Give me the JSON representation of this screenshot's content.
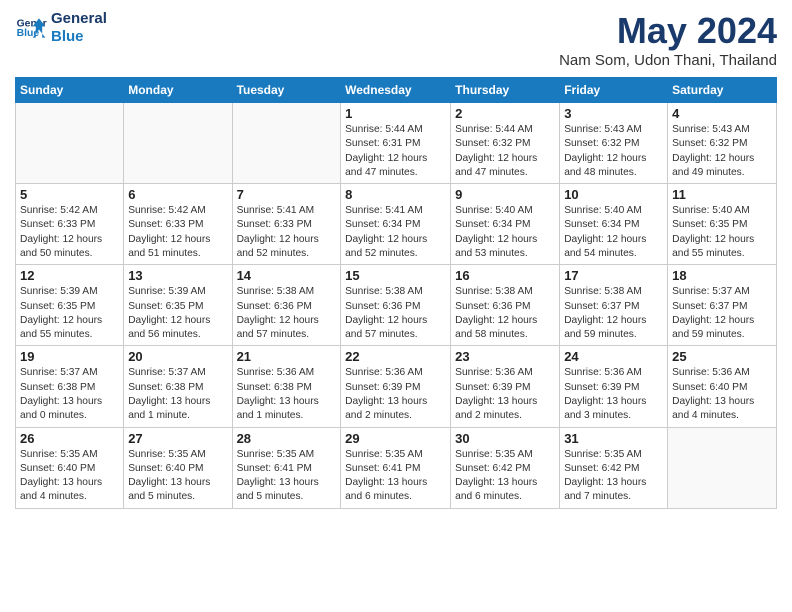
{
  "header": {
    "logo_line1": "General",
    "logo_line2": "Blue",
    "month_year": "May 2024",
    "location": "Nam Som, Udon Thani, Thailand"
  },
  "weekdays": [
    "Sunday",
    "Monday",
    "Tuesday",
    "Wednesday",
    "Thursday",
    "Friday",
    "Saturday"
  ],
  "weeks": [
    [
      {
        "day": "",
        "info": ""
      },
      {
        "day": "",
        "info": ""
      },
      {
        "day": "",
        "info": ""
      },
      {
        "day": "1",
        "info": "Sunrise: 5:44 AM\nSunset: 6:31 PM\nDaylight: 12 hours\nand 47 minutes."
      },
      {
        "day": "2",
        "info": "Sunrise: 5:44 AM\nSunset: 6:32 PM\nDaylight: 12 hours\nand 47 minutes."
      },
      {
        "day": "3",
        "info": "Sunrise: 5:43 AM\nSunset: 6:32 PM\nDaylight: 12 hours\nand 48 minutes."
      },
      {
        "day": "4",
        "info": "Sunrise: 5:43 AM\nSunset: 6:32 PM\nDaylight: 12 hours\nand 49 minutes."
      }
    ],
    [
      {
        "day": "5",
        "info": "Sunrise: 5:42 AM\nSunset: 6:33 PM\nDaylight: 12 hours\nand 50 minutes."
      },
      {
        "day": "6",
        "info": "Sunrise: 5:42 AM\nSunset: 6:33 PM\nDaylight: 12 hours\nand 51 minutes."
      },
      {
        "day": "7",
        "info": "Sunrise: 5:41 AM\nSunset: 6:33 PM\nDaylight: 12 hours\nand 52 minutes."
      },
      {
        "day": "8",
        "info": "Sunrise: 5:41 AM\nSunset: 6:34 PM\nDaylight: 12 hours\nand 52 minutes."
      },
      {
        "day": "9",
        "info": "Sunrise: 5:40 AM\nSunset: 6:34 PM\nDaylight: 12 hours\nand 53 minutes."
      },
      {
        "day": "10",
        "info": "Sunrise: 5:40 AM\nSunset: 6:34 PM\nDaylight: 12 hours\nand 54 minutes."
      },
      {
        "day": "11",
        "info": "Sunrise: 5:40 AM\nSunset: 6:35 PM\nDaylight: 12 hours\nand 55 minutes."
      }
    ],
    [
      {
        "day": "12",
        "info": "Sunrise: 5:39 AM\nSunset: 6:35 PM\nDaylight: 12 hours\nand 55 minutes."
      },
      {
        "day": "13",
        "info": "Sunrise: 5:39 AM\nSunset: 6:35 PM\nDaylight: 12 hours\nand 56 minutes."
      },
      {
        "day": "14",
        "info": "Sunrise: 5:38 AM\nSunset: 6:36 PM\nDaylight: 12 hours\nand 57 minutes."
      },
      {
        "day": "15",
        "info": "Sunrise: 5:38 AM\nSunset: 6:36 PM\nDaylight: 12 hours\nand 57 minutes."
      },
      {
        "day": "16",
        "info": "Sunrise: 5:38 AM\nSunset: 6:36 PM\nDaylight: 12 hours\nand 58 minutes."
      },
      {
        "day": "17",
        "info": "Sunrise: 5:38 AM\nSunset: 6:37 PM\nDaylight: 12 hours\nand 59 minutes."
      },
      {
        "day": "18",
        "info": "Sunrise: 5:37 AM\nSunset: 6:37 PM\nDaylight: 12 hours\nand 59 minutes."
      }
    ],
    [
      {
        "day": "19",
        "info": "Sunrise: 5:37 AM\nSunset: 6:38 PM\nDaylight: 13 hours\nand 0 minutes."
      },
      {
        "day": "20",
        "info": "Sunrise: 5:37 AM\nSunset: 6:38 PM\nDaylight: 13 hours\nand 1 minute."
      },
      {
        "day": "21",
        "info": "Sunrise: 5:36 AM\nSunset: 6:38 PM\nDaylight: 13 hours\nand 1 minutes."
      },
      {
        "day": "22",
        "info": "Sunrise: 5:36 AM\nSunset: 6:39 PM\nDaylight: 13 hours\nand 2 minutes."
      },
      {
        "day": "23",
        "info": "Sunrise: 5:36 AM\nSunset: 6:39 PM\nDaylight: 13 hours\nand 2 minutes."
      },
      {
        "day": "24",
        "info": "Sunrise: 5:36 AM\nSunset: 6:39 PM\nDaylight: 13 hours\nand 3 minutes."
      },
      {
        "day": "25",
        "info": "Sunrise: 5:36 AM\nSunset: 6:40 PM\nDaylight: 13 hours\nand 4 minutes."
      }
    ],
    [
      {
        "day": "26",
        "info": "Sunrise: 5:35 AM\nSunset: 6:40 PM\nDaylight: 13 hours\nand 4 minutes."
      },
      {
        "day": "27",
        "info": "Sunrise: 5:35 AM\nSunset: 6:40 PM\nDaylight: 13 hours\nand 5 minutes."
      },
      {
        "day": "28",
        "info": "Sunrise: 5:35 AM\nSunset: 6:41 PM\nDaylight: 13 hours\nand 5 minutes."
      },
      {
        "day": "29",
        "info": "Sunrise: 5:35 AM\nSunset: 6:41 PM\nDaylight: 13 hours\nand 6 minutes."
      },
      {
        "day": "30",
        "info": "Sunrise: 5:35 AM\nSunset: 6:42 PM\nDaylight: 13 hours\nand 6 minutes."
      },
      {
        "day": "31",
        "info": "Sunrise: 5:35 AM\nSunset: 6:42 PM\nDaylight: 13 hours\nand 7 minutes."
      },
      {
        "day": "",
        "info": ""
      }
    ]
  ]
}
